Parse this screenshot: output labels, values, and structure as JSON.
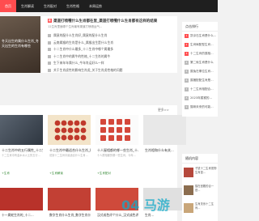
{
  "nav": {
    "items": [
      "首页",
      "生肖解读",
      "生肖配对",
      "生肖性格",
      "本周运势"
    ]
  },
  "feature": {
    "hero_text": "冬天出生的属什么生肖_冬天出生的生肖有哪些",
    "title": "渠道打喷嚏什么生肖都在里_渠道打喷嚏什么生肖都有这样的结果",
    "tag": "新",
    "description": "12生肖里面哪个生肖最有渠道打喷嚏运气...",
    "list": [
      "属鼠的配什么生肖好_属鼠的配什么生肖",
      "云南属猴的生肖是什么_属猴出生是什么生肖",
      "十二生肖中什么最多_十二生肖中哪个属最多",
      "十二生肖中的属牛的性格_十二生肖的属牛",
      "生下来年年属什么_今年肖运好么一样",
      "关于生肖虎性的影响生肖虎_关于生肖虎性格的问题"
    ]
  },
  "more_label": "更多>>",
  "cards": [
    {
      "title": "十二生肖中的五行属性_十二生肖属性",
      "desc": "十二生肖中有金木水火土的五行...",
      "tag": "+生肖"
    },
    {
      "title": "十二生肖中最适合什么生肖_能够...",
      "desc": "说到十二生肖中最适合什么生肖...",
      "tag": "+生肖解读"
    },
    {
      "title": "十人屋相都的哪一些生肖_十人屋...",
      "desc": "十人屋相都的哪一些生肖，今年...",
      "tag": "+生肖配对"
    },
    {
      "title": "生肖相和什么有关...",
      "desc": "",
      "tag": ""
    }
  ],
  "cards_row2": [
    {
      "title": "十一属蛇生肖的_十二..."
    },
    {
      "title": "数字生肖什么生肖_数字生肖什么生肖..."
    },
    {
      "title": "汉式成色评个什么_汉式成色评个好..."
    },
    {
      "title": "生肖..."
    }
  ],
  "sidebar": {
    "hot_title": "点击排行",
    "hot_list": [
      "凯京石生肖是什么...",
      "生肖局配型生肖...",
      "十二生肖的属相...",
      "第二秋生肖是什么",
      "属兔在哪位生肖...",
      "属猪配配生肖是...",
      "十二生肖相配合...",
      "2023年属猴的...",
      "猫咪未来的可能..."
    ],
    "rec_title": "随机内容",
    "rec_list": [
      "子鼠十二生肖宠物生肖鼠...",
      "猫在宫殿的合一是...",
      "生肖关系十二生肖..."
    ]
  },
  "watermark": "04 马游"
}
